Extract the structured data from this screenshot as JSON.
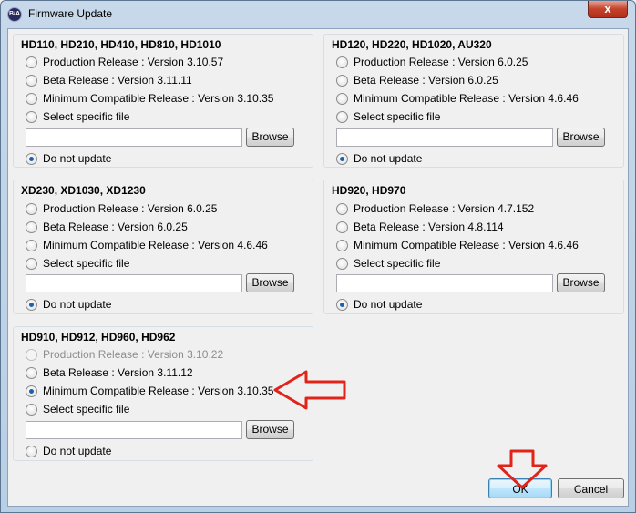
{
  "window": {
    "title": "Firmware Update",
    "icon_text": "B/A",
    "close_label": "x"
  },
  "groups": [
    {
      "title": "HD110, HD210, HD410, HD810, HD1010",
      "options": [
        {
          "label": "Production Release : Version 3.10.57",
          "checked": false,
          "disabled": false
        },
        {
          "label": "Beta Release : Version 3.11.11",
          "checked": false,
          "disabled": false
        },
        {
          "label": "Minimum Compatible Release : Version 3.10.35",
          "checked": false,
          "disabled": false
        },
        {
          "label": "Select specific file",
          "checked": false,
          "disabled": false
        }
      ],
      "file_value": "",
      "browse_label": "Browse",
      "no_update_label": "Do not update",
      "no_update_checked": true
    },
    {
      "title": "HD120, HD220, HD1020, AU320",
      "options": [
        {
          "label": "Production Release : Version 6.0.25",
          "checked": false,
          "disabled": false
        },
        {
          "label": "Beta Release : Version 6.0.25",
          "checked": false,
          "disabled": false
        },
        {
          "label": "Minimum Compatible Release : Version 4.6.46",
          "checked": false,
          "disabled": false
        },
        {
          "label": "Select specific file",
          "checked": false,
          "disabled": false
        }
      ],
      "file_value": "",
      "browse_label": "Browse",
      "no_update_label": "Do not update",
      "no_update_checked": true
    },
    {
      "title": "XD230, XD1030, XD1230",
      "options": [
        {
          "label": "Production Release : Version 6.0.25",
          "checked": false,
          "disabled": false
        },
        {
          "label": "Beta Release : Version 6.0.25",
          "checked": false,
          "disabled": false
        },
        {
          "label": "Minimum Compatible Release : Version 4.6.46",
          "checked": false,
          "disabled": false
        },
        {
          "label": "Select specific file",
          "checked": false,
          "disabled": false
        }
      ],
      "file_value": "",
      "browse_label": "Browse",
      "no_update_label": "Do not update",
      "no_update_checked": true
    },
    {
      "title": "HD920, HD970",
      "options": [
        {
          "label": "Production Release : Version 4.7.152",
          "checked": false,
          "disabled": false
        },
        {
          "label": "Beta Release : Version 4.8.114",
          "checked": false,
          "disabled": false
        },
        {
          "label": "Minimum Compatible Release : Version 4.6.46",
          "checked": false,
          "disabled": false
        },
        {
          "label": "Select specific file",
          "checked": false,
          "disabled": false
        }
      ],
      "file_value": "",
      "browse_label": "Browse",
      "no_update_label": "Do not update",
      "no_update_checked": true
    },
    {
      "title": "HD910, HD912, HD960, HD962",
      "options": [
        {
          "label": "Production Release : Version 3.10.22",
          "checked": false,
          "disabled": true
        },
        {
          "label": "Beta Release : Version 3.11.12",
          "checked": false,
          "disabled": false
        },
        {
          "label": "Minimum Compatible Release : Version 3.10.35",
          "checked": true,
          "disabled": false
        },
        {
          "label": "Select specific file",
          "checked": false,
          "disabled": false
        }
      ],
      "file_value": "",
      "browse_label": "Browse",
      "no_update_label": "Do not update",
      "no_update_checked": false
    }
  ],
  "buttons": {
    "ok_label": "OK",
    "cancel_label": "Cancel"
  },
  "annotation_color": "#e2231a"
}
